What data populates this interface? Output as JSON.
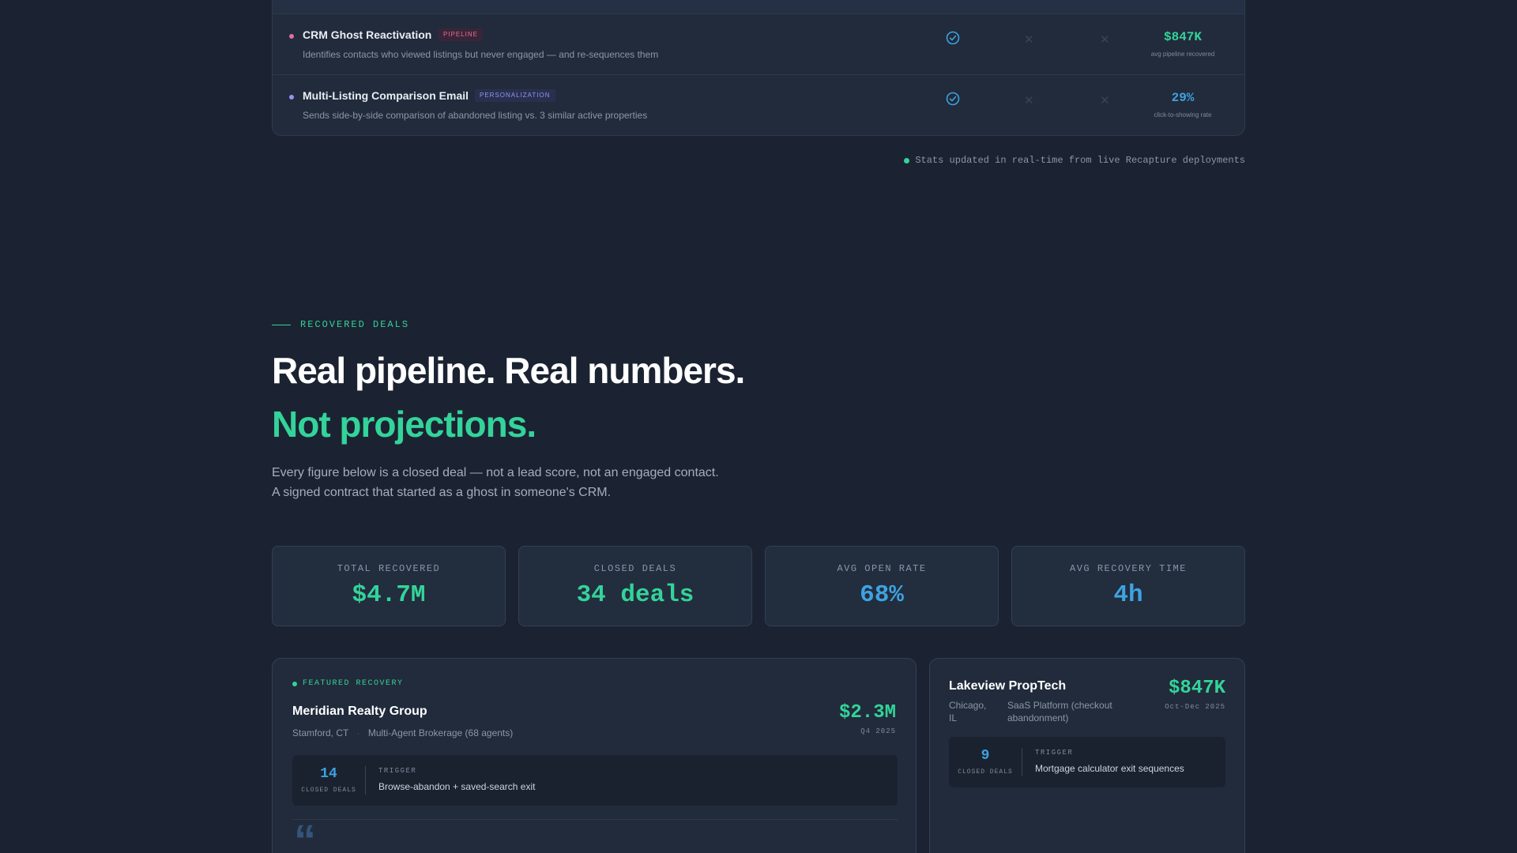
{
  "table": {
    "rows": [
      {
        "name": "CRM Ghost Reactivation",
        "badge": "PIPELINE",
        "description": "Identifies contacts who viewed listings but never engaged — and re-sequences them",
        "stat_value": "$847K",
        "stat_label": "avg pipeline recovered",
        "dot_color": "#e0709e",
        "stat_color": "#34d399"
      },
      {
        "name": "Multi-Listing Comparison Email",
        "badge": "PERSONALIZATION",
        "description": "Sends side-by-side comparison of abandoned listing vs. 3 similar active properties",
        "stat_value": "29%",
        "stat_label": "click-to-showing rate",
        "dot_color": "#8f98ea",
        "stat_color": "#3ea2e0"
      }
    ],
    "note": "Stats updated in real-time from live Recapture deployments"
  },
  "section": {
    "eyebrow": "RECOVERED DEALS",
    "heading": "Real pipeline. Real numbers.",
    "heading_accent": "Not projections.",
    "lead_line1": "Every figure below is a closed deal — not a lead score, not an engaged contact.",
    "lead_line2": "A signed contract that started as a ghost in someone's CRM."
  },
  "stats": [
    {
      "label": "TOTAL RECOVERED",
      "value": "$4.7M"
    },
    {
      "label": "CLOSED DEALS",
      "value": "34 deals"
    },
    {
      "label": "AVG OPEN RATE",
      "value": "68%"
    },
    {
      "label": "AVG RECOVERY TIME",
      "value": "4h"
    }
  ],
  "featured": {
    "tag": "FEATURED RECOVERY",
    "name": "Meridian Realty Group",
    "location": "Stamford, CT",
    "type": "Multi-Agent Brokerage (68 agents)",
    "value": "$2.3M",
    "period": "Q4 2025",
    "closed_deals": "14",
    "closed_label": "CLOSED DEALS",
    "trigger_label": "TRIGGER",
    "trigger": "Browse-abandon + saved-search exit",
    "quote_mark": "“"
  },
  "secondary": {
    "name": "Lakeview PropTech",
    "location_line1": "Chicago,",
    "location_line2": "IL",
    "type_line1": "SaaS Platform (checkout",
    "type_line2": "abandonment)",
    "value": "$847K",
    "period": "Oct-Dec 2025",
    "closed_deals": "9",
    "closed_label": "CLOSED DEALS",
    "trigger_label": "TRIGGER",
    "trigger": "Mortgage calculator exit sequences"
  }
}
